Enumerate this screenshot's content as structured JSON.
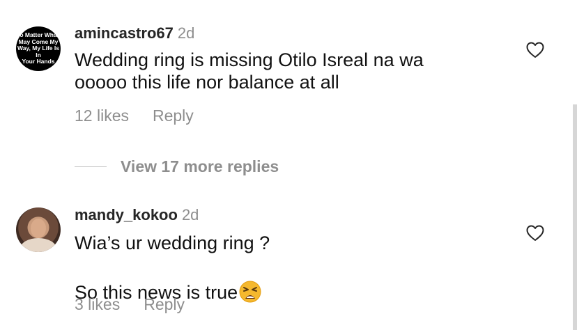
{
  "comments": [
    {
      "username": "amincastro67",
      "time": "2d",
      "avatar_text": "o Matter Wha\nMay Come My\nWay, My Life Is\nIn\nYour Hands",
      "text": "Wedding ring is missing Otilo Isreal na wa\nooooo  this life nor balance at all",
      "likes": "12 likes",
      "reply": "Reply",
      "icon": "heart-outline-icon"
    },
    {
      "username": "mandy_kokoo",
      "time": "2d",
      "text_line1": "Wia’s ur wedding ring ?",
      "text_line2": "So this news is true",
      "emoji": "weary-face-emoji",
      "likes": "3 likes",
      "reply": "Reply",
      "icon": "heart-outline-icon"
    }
  ],
  "view_replies": "View 17 more replies",
  "colors": {
    "username": "#262626",
    "secondary": "#8e8e8e",
    "divider": "#c7c7c7",
    "emoji": "#f5b82e"
  }
}
